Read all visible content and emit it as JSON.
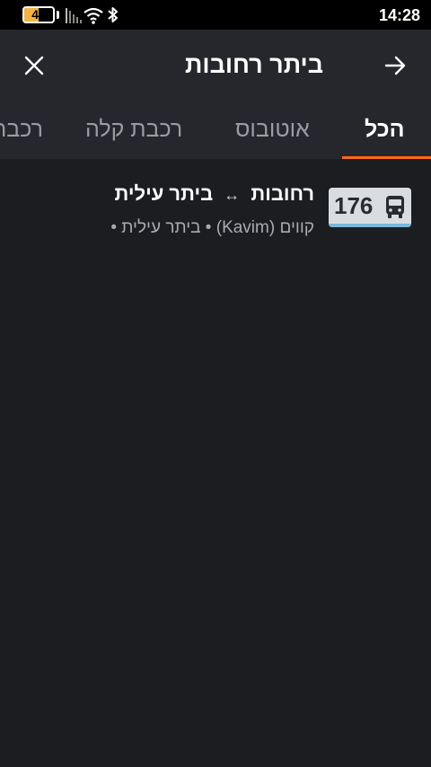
{
  "status_bar": {
    "battery_level": "49",
    "battery_fraction": 0.49,
    "time": "14:28",
    "icons": [
      "battery-icon",
      "cellular-signal-icon",
      "wifi-icon",
      "bluetooth-icon"
    ]
  },
  "toolbar": {
    "title": "ביתר רחובות",
    "close_icon": "close-icon",
    "back_icon": "arrow-right-icon"
  },
  "tabs": [
    {
      "label": "הכל",
      "active": true
    },
    {
      "label": "אוטובוס",
      "active": false
    },
    {
      "label": "רכבת קלה",
      "active": false
    },
    {
      "label": "רכבת",
      "active": false
    }
  ],
  "results": [
    {
      "line_number": "176",
      "icon": "bus-icon",
      "from": "ביתר עילית",
      "separator": "↔",
      "to": "רחובות",
      "subtitle": "קווים (Kavim) • ביתר עילית •"
    }
  ],
  "colors": {
    "background": "#1c1d20",
    "toolbar": "#26272c",
    "accent": "#ff6a13",
    "badge": "#d9dde2",
    "badge_bar": "#7ab6dc"
  }
}
